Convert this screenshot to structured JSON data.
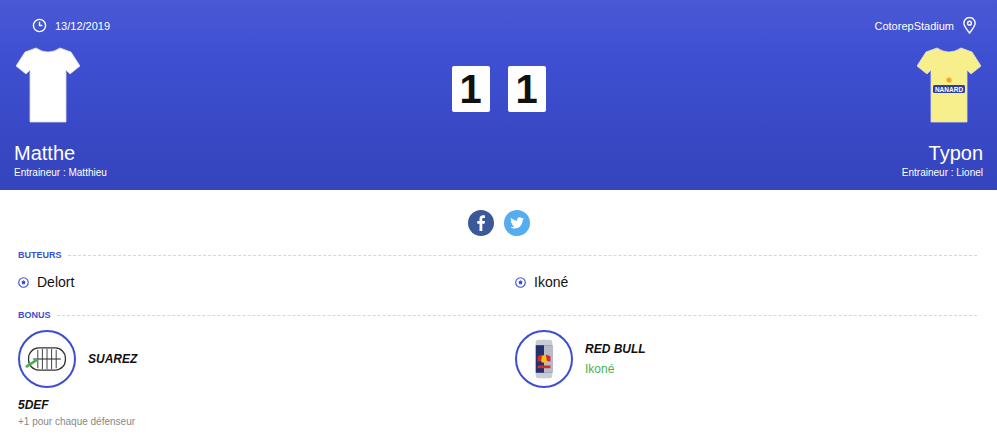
{
  "match": {
    "date": "13/12/2019",
    "stadium": "CotorepStadium"
  },
  "teams": [
    {
      "side": "home",
      "name": "Matthe",
      "coach": "Entraineur : Matthieu",
      "score": "1",
      "color": "#ffffff",
      "sponsor": null
    },
    {
      "side": "away",
      "name": "Typon",
      "coach": "Entraineur : Lionel",
      "score": "1",
      "color": "#f7ef8c",
      "sponsor": "NANARD"
    }
  ],
  "scorers": {
    "title": "BUTEURS",
    "home": [
      "Delort"
    ],
    "away": [
      "Ikoné"
    ]
  },
  "bonus": {
    "title": "BONUS",
    "home": [
      {
        "kind": "teeth",
        "name": "SUAREZ",
        "player": null,
        "desc": null
      },
      {
        "kind": "plain",
        "name": "5DEF",
        "player": null,
        "desc": "+1 pour chaque défenseur"
      }
    ],
    "away": [
      {
        "kind": "can",
        "name": "RED BULL",
        "player": "Ikoné",
        "desc": null
      }
    ]
  }
}
